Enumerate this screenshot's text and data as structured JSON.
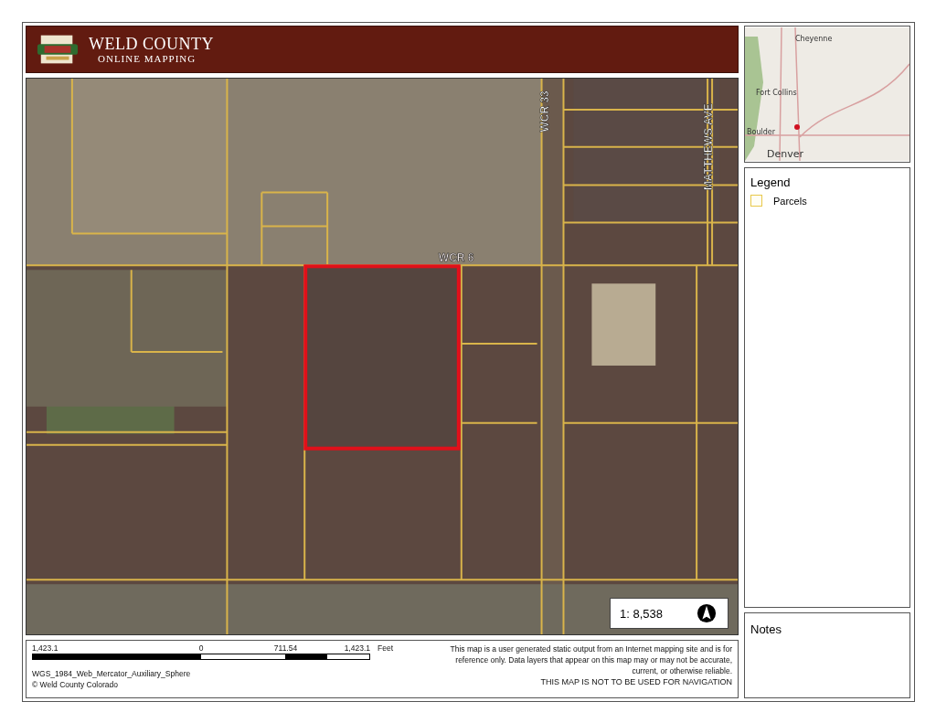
{
  "header": {
    "title": "WELD COUNTY",
    "subtitle": "ONLINE MAPPING"
  },
  "map": {
    "road_labels": [
      {
        "text": "WCR 33",
        "kind": "vertical"
      },
      {
        "text": "MATTHEWS AVE",
        "kind": "vertical"
      },
      {
        "text": "WCR 6",
        "kind": "horizontal"
      }
    ],
    "scale": "1: 8,538"
  },
  "inset_map": {
    "cities": [
      "Cheyenne",
      "Fort Collins",
      "Boulder",
      "Denver"
    ]
  },
  "legend": {
    "title": "Legend",
    "items": [
      {
        "label": "Parcels",
        "color": "#e8c84a"
      }
    ]
  },
  "notes": {
    "title": "Notes"
  },
  "scale_bar": {
    "labels": [
      "1,423.1",
      "0",
      "711.54",
      "1,423.1"
    ],
    "unit": "Feet"
  },
  "projection": "WGS_1984_Web_Mercator_Auxiliary_Sphere",
  "copyright": "© Weld County Colorado",
  "disclaimer": "This map is a user generated static output from an Internet mapping site and is for reference only. Data layers that appear on this map may or may not be accurate, current, or otherwise reliable.",
  "warning": "THIS MAP IS NOT TO BE USED FOR NAVIGATION"
}
